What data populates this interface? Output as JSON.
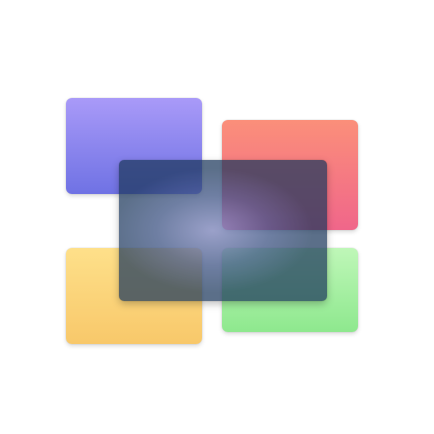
{
  "icon": {
    "name": "stacked-frosted-windows-icon",
    "colors": {
      "top_left": [
        "#a99af8",
        "#6f72e4"
      ],
      "top_right": [
        "#fb8f7a",
        "#f0668a"
      ],
      "bottom_left": [
        "#fee08a",
        "#f8c86a"
      ],
      "bottom_right": [
        "#bff7b8",
        "#8ee88e"
      ],
      "glass_overlay": "rgba(28, 56, 92, 0.72)"
    }
  }
}
